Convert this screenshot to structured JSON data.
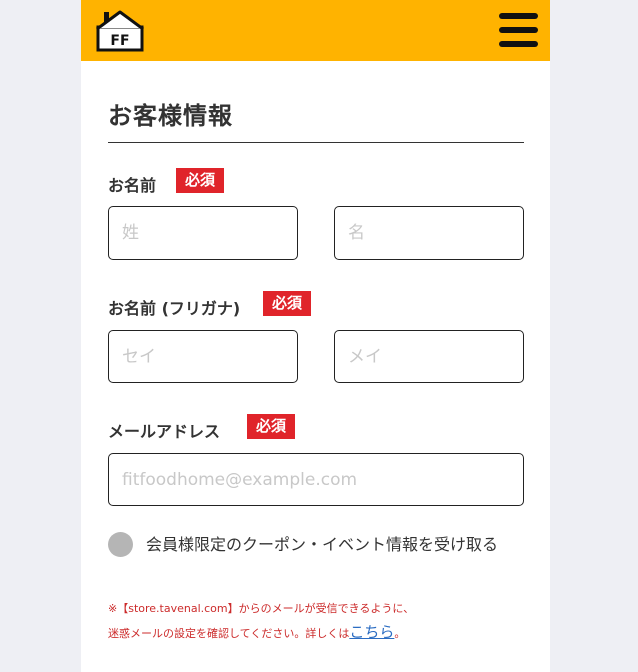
{
  "header": {
    "logo_text": "FF"
  },
  "form": {
    "title": "お客様情報",
    "required_label": "必須",
    "name": {
      "label": "お名前",
      "last_placeholder": "姓",
      "first_placeholder": "名"
    },
    "kana": {
      "label": "お名前 (フリガナ)",
      "last_placeholder": "セイ",
      "first_placeholder": "メイ"
    },
    "email": {
      "label": "メールアドレス",
      "placeholder": "fitfoodhome@example.com"
    },
    "opt_in": {
      "label": "会員様限定のクーポン・イベント情報を受け取る",
      "checked": false
    },
    "notice": {
      "line1": "※【store.tavenal.com】からのメールが受信できるように、",
      "line2_prefix": "迷惑メールの設定を確認してください。詳しくは",
      "link_text": "こちら",
      "line2_suffix": "。"
    }
  },
  "colors": {
    "header_bg": "#ffb300",
    "required_badge": "#e0242a",
    "notice_text": "#cc2b2b",
    "link": "#2a6cc2",
    "checkbox_unchecked": "#b5b5b5"
  },
  "icons": {
    "logo": "house-logo-icon",
    "menu": "hamburger-menu-icon"
  }
}
